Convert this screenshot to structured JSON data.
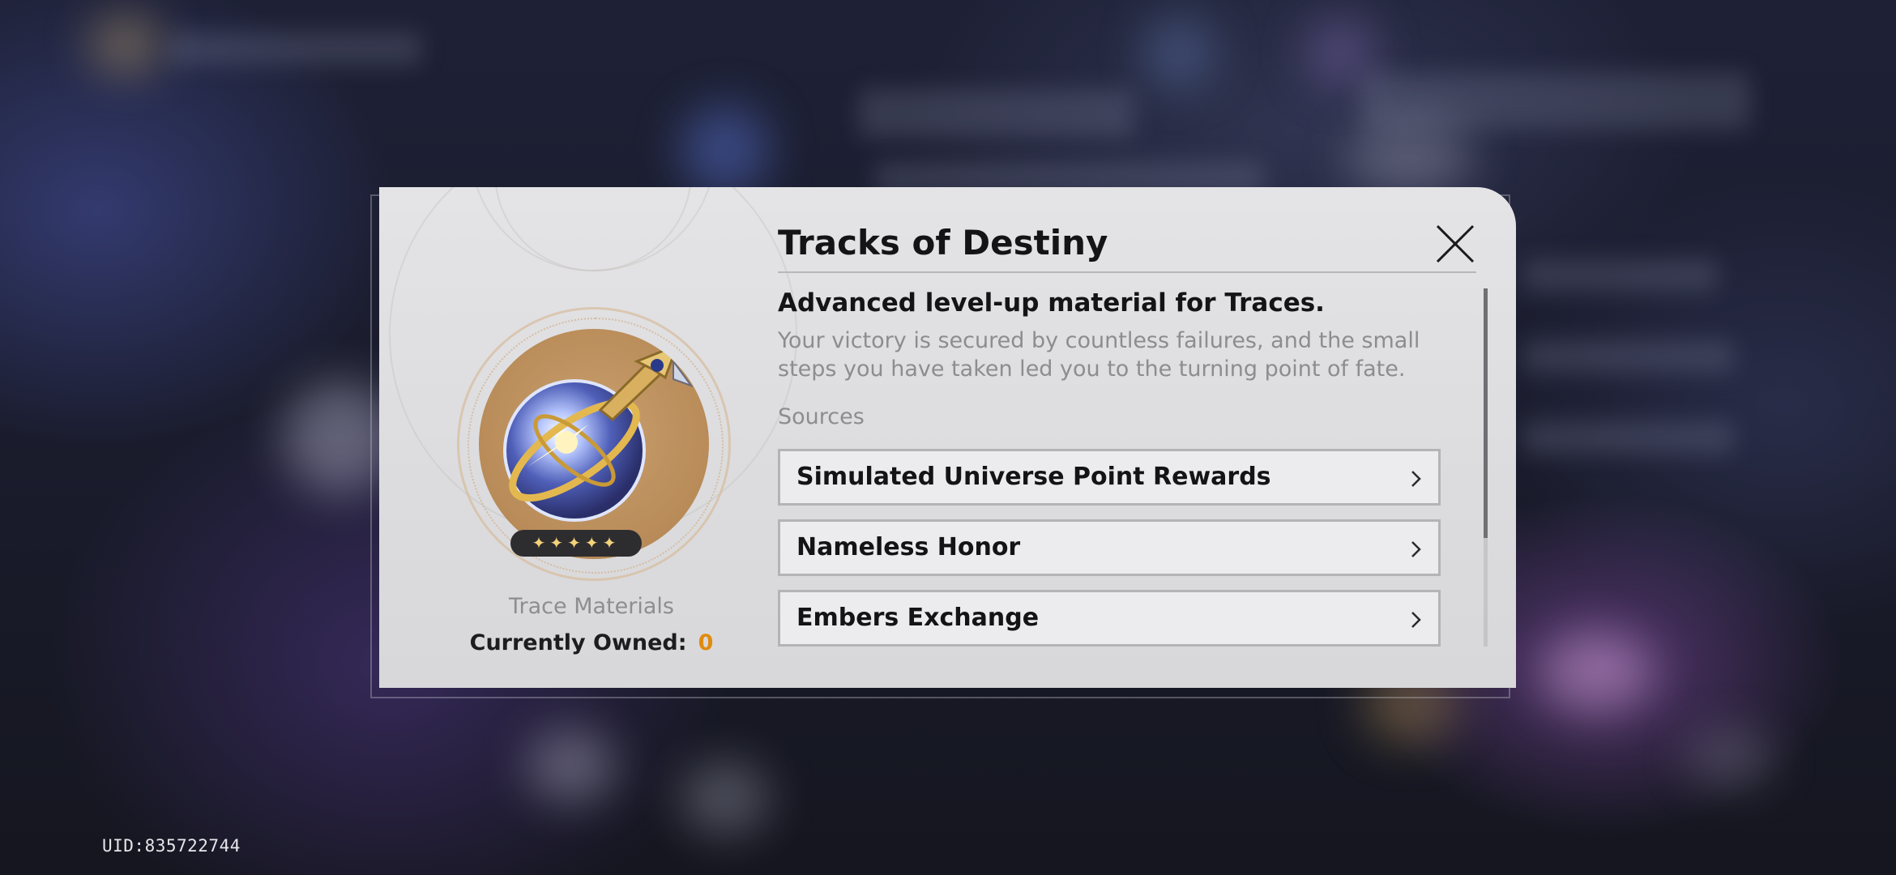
{
  "uid": "UID:835722744",
  "item": {
    "name": "Tracks of Destiny",
    "rarity": 5,
    "stars": "✦✦✦✦✦",
    "type": "Trace Materials",
    "owned_label": "Currently Owned:",
    "owned_value": "0",
    "subtitle": "Advanced level-up material for Traces.",
    "description": "Your victory is secured by countless failures, and the small steps you have taken led you to the turning point of fate."
  },
  "sources": {
    "label": "Sources",
    "items": [
      {
        "label": "Simulated Universe Point Rewards"
      },
      {
        "label": "Nameless Honor"
      },
      {
        "label": "Embers Exchange"
      }
    ]
  },
  "icons": {
    "close": "close-icon",
    "chevron": "chevron-right-icon"
  },
  "colors": {
    "accent_owned": "#e08b10",
    "star": "#f3d27a",
    "panel": "#e4e4e6"
  }
}
